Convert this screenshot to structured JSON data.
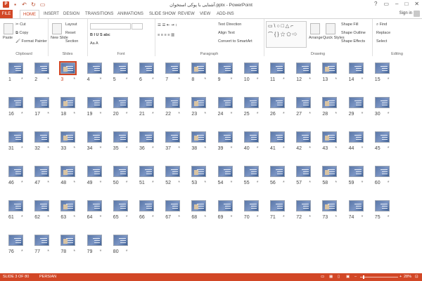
{
  "app": {
    "title": "آشنایی با پوکی استخوان.pptx - PowerPoint"
  },
  "window_controls": [
    "?",
    "▭",
    "–",
    "□",
    "✕"
  ],
  "tabs": [
    "FILE",
    "HOME",
    "INSERT",
    "DESIGN",
    "TRANSITIONS",
    "ANIMATIONS",
    "SLIDE SHOW",
    "REVIEW",
    "VIEW",
    "ADD-INS"
  ],
  "active_tab": "HOME",
  "account": {
    "signin": "Sign in"
  },
  "ribbon": {
    "clipboard": {
      "label": "Clipboard",
      "paste": "Paste",
      "cut": "Cut",
      "copy": "Copy",
      "format_painter": "Format Painter"
    },
    "slides": {
      "label": "Slides",
      "new_slide": "New Slide",
      "layout": "Layout",
      "reset": "Reset",
      "section": "Section"
    },
    "font": {
      "label": "Font"
    },
    "paragraph": {
      "label": "Paragraph",
      "text_direction": "Text Direction",
      "align_text": "Align Text",
      "convert_smartart": "Convert to SmartArt"
    },
    "drawing": {
      "label": "Drawing",
      "arrange": "Arrange",
      "quick_styles": "Quick Styles",
      "shape_fill": "Shape Fill",
      "shape_outline": "Shape Outline",
      "shape_effects": "Shape Effects"
    },
    "editing": {
      "label": "Editing",
      "find": "Find",
      "replace": "Replace",
      "select": "Select"
    }
  },
  "slides": [
    "1",
    "2",
    "3",
    "4",
    "5",
    "6",
    "7",
    "8",
    "9",
    "10",
    "11",
    "12",
    "13",
    "14",
    "15",
    "16",
    "17",
    "18",
    "19",
    "20",
    "21",
    "22",
    "23",
    "24",
    "25",
    "26",
    "27",
    "28",
    "29",
    "30",
    "31",
    "32",
    "33",
    "34",
    "35",
    "36",
    "37",
    "38",
    "39",
    "40",
    "41",
    "42",
    "43",
    "44",
    "45",
    "46",
    "47",
    "48",
    "49",
    "50",
    "51",
    "52",
    "53",
    "54",
    "55",
    "56",
    "57",
    "58",
    "59",
    "60",
    "61",
    "62",
    "63",
    "64",
    "65",
    "66",
    "67",
    "68",
    "69",
    "70",
    "71",
    "72",
    "73",
    "74",
    "75",
    "76",
    "77",
    "78",
    "79",
    "80"
  ],
  "selected_slide": "3",
  "status": {
    "slide": "SLIDE 3 OF 80",
    "language": "PERSIAN",
    "zoom": "28%"
  },
  "colors": {
    "accent": "#d24726",
    "slide_bg": "#5a77a8"
  }
}
